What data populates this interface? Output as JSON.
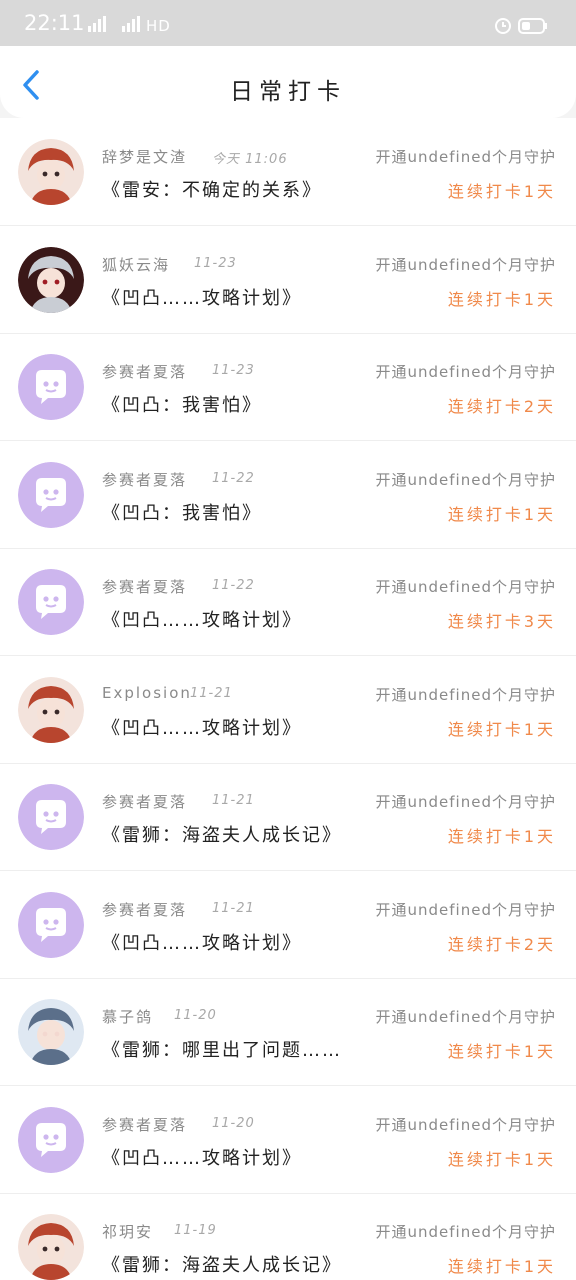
{
  "status_bar": {
    "time": "22:11",
    "signal_text": "⁴ᴳ▐▌▐ ⁴ᴳ▐▌▐ HD",
    "icons": [
      "signal-icon",
      "alarm-icon",
      "battery-icon"
    ]
  },
  "header": {
    "title": "日常打卡",
    "back_icon": "chevron-left-icon"
  },
  "colors": {
    "accent_blue": "#2f8ff0",
    "streak_orange": "#f0894a",
    "avatar_purple": "#cdb6ee"
  },
  "entries": [
    {
      "name": "辞梦是文渣",
      "date": "今天 11:06",
      "title": "《雷安：不确定的关系》",
      "guard": "开通undefined个月守护",
      "streak": "连续打卡1天",
      "avatar": "anime-avatar"
    },
    {
      "name": "狐妖云海",
      "date": "11-23",
      "title": "《凹凸……攻略计划》",
      "guard": "开通undefined个月守护",
      "streak": "连续打卡1天",
      "avatar": "anime-avatar"
    },
    {
      "name": "参赛者夏落",
      "date": "11-23",
      "title": "《凹凸：我害怕》",
      "guard": "开通undefined个月守护",
      "streak": "连续打卡2天",
      "avatar": "default-chat-avatar"
    },
    {
      "name": "参赛者夏落",
      "date": "11-22",
      "title": "《凹凸：我害怕》",
      "guard": "开通undefined个月守护",
      "streak": "连续打卡1天",
      "avatar": "default-chat-avatar"
    },
    {
      "name": "参赛者夏落",
      "date": "11-22",
      "title": "《凹凸……攻略计划》",
      "guard": "开通undefined个月守护",
      "streak": "连续打卡3天",
      "avatar": "default-chat-avatar"
    },
    {
      "name": "Explosion",
      "date": "11-21",
      "title": "《凹凸……攻略计划》",
      "guard": "开通undefined个月守护",
      "streak": "连续打卡1天",
      "avatar": "anime-avatar"
    },
    {
      "name": "参赛者夏落",
      "date": "11-21",
      "title": "《雷狮：海盗夫人成长记》",
      "guard": "开通undefined个月守护",
      "streak": "连续打卡1天",
      "avatar": "default-chat-avatar"
    },
    {
      "name": "参赛者夏落",
      "date": "11-21",
      "title": "《凹凸……攻略计划》",
      "guard": "开通undefined个月守护",
      "streak": "连续打卡2天",
      "avatar": "default-chat-avatar"
    },
    {
      "name": "慕子鸽",
      "date": "11-20",
      "title": "《雷狮：哪里出了问题……",
      "guard": "开通undefined个月守护",
      "streak": "连续打卡1天",
      "avatar": "anime-avatar"
    },
    {
      "name": "参赛者夏落",
      "date": "11-20",
      "title": "《凹凸……攻略计划》",
      "guard": "开通undefined个月守护",
      "streak": "连续打卡1天",
      "avatar": "default-chat-avatar"
    },
    {
      "name": "祁玥安",
      "date": "11-19",
      "title": "《雷狮：海盗夫人成长记》",
      "guard": "开通undefined个月守护",
      "streak": "连续打卡1天",
      "avatar": "anime-avatar"
    }
  ]
}
